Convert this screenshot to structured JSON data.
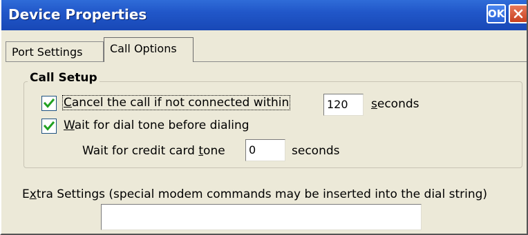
{
  "window": {
    "title": "Device Properties",
    "ok_label": "OK"
  },
  "tabs": [
    {
      "label": "Port Settings",
      "active": false
    },
    {
      "label": "Call Options",
      "active": true
    }
  ],
  "call_setup": {
    "group_title": "Call Setup",
    "cancel_call": {
      "checked": true,
      "label_prefix": "C",
      "label_rest": "ancel the call if not connected within",
      "value": "120",
      "units_prefix": "s",
      "units_rest": "econds"
    },
    "wait_dial_tone": {
      "checked": true,
      "label_prefix": "W",
      "label_rest": "ait for dial tone before dialing"
    },
    "credit_card_tone": {
      "label_before": "Wait for credit card ",
      "label_underlined": "t",
      "label_after": "one",
      "value": "0",
      "units": "seconds"
    }
  },
  "extra_settings": {
    "label_before": "E",
    "label_underlined": "x",
    "label_after": "tra Settings (special modem commands may be inserted into the dial string)",
    "value": ""
  },
  "icons": {
    "close": "close-icon",
    "checkmark": "checkmark-icon"
  },
  "colors": {
    "titlebar": "#2157c9",
    "close_button": "#c8401e",
    "checkmark": "#21a121",
    "window_bg": "#ece9d8"
  }
}
